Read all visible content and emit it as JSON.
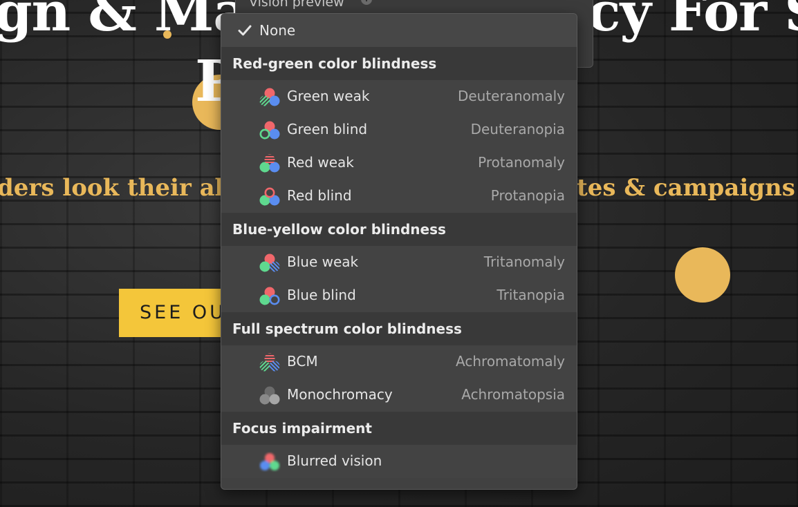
{
  "page": {
    "hero_left": "gn & Ma",
    "hero_right": "cy For S",
    "hero_p": "P",
    "tagline_left": "ders look their abs",
    "tagline_right": "tes & campaigns th",
    "cta_label": "SEE OUR"
  },
  "select": {
    "label": "Vision preview",
    "info_icon": "info-icon"
  },
  "menu": {
    "none": {
      "label": "None",
      "icon": "check-icon"
    },
    "groups": [
      {
        "title": "Red-green color blindness",
        "options": [
          {
            "name": "Green weak",
            "sci": "Deuteranomaly"
          },
          {
            "name": "Green blind",
            "sci": "Deuteranopia"
          },
          {
            "name": "Red weak",
            "sci": "Protanomaly"
          },
          {
            "name": "Red blind",
            "sci": "Protanopia"
          }
        ]
      },
      {
        "title": "Blue-yellow color blindness",
        "options": [
          {
            "name": "Blue weak",
            "sci": "Tritanomaly"
          },
          {
            "name": "Blue blind",
            "sci": "Tritanopia"
          }
        ]
      },
      {
        "title": "Full spectrum color blindness",
        "options": [
          {
            "name": "BCM",
            "sci": "Achromatomaly"
          },
          {
            "name": "Monochromacy",
            "sci": "Achromatopsia"
          }
        ]
      },
      {
        "title": "Focus impairment",
        "options": [
          {
            "name": "Blurred vision",
            "sci": ""
          }
        ]
      }
    ]
  },
  "colors": {
    "red": "#f0676b",
    "green": "#5fd98f",
    "blue": "#5a8df0",
    "gold": "#e9b85a",
    "cta_yellow": "#f4c63a",
    "menu_bg": "#434343",
    "header_bg": "#393939"
  }
}
